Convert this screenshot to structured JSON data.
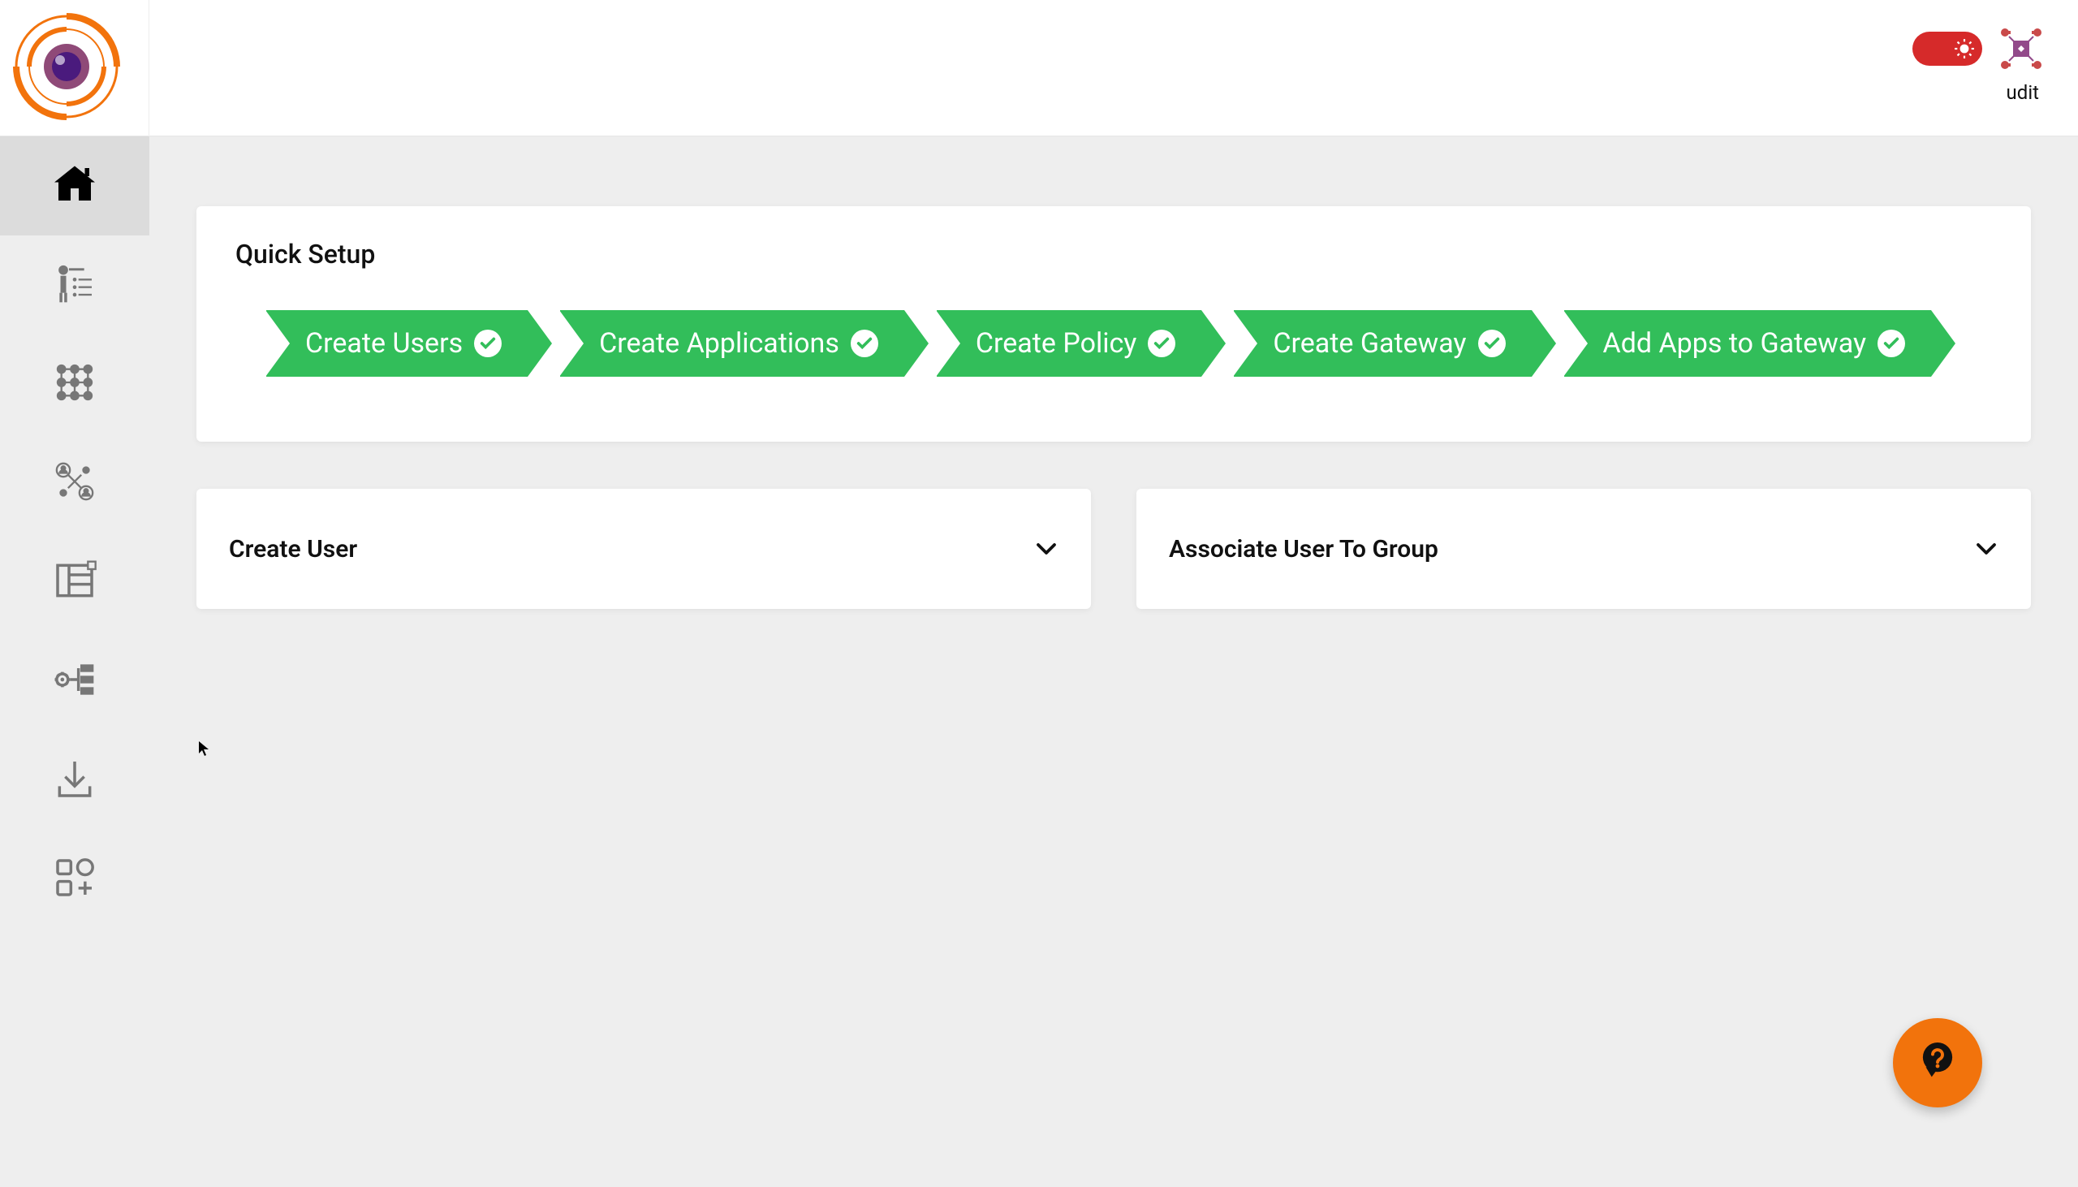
{
  "header": {
    "user_name": "udit"
  },
  "sidebar": {
    "items": [
      {
        "name": "home"
      },
      {
        "name": "onboarding"
      },
      {
        "name": "grid"
      },
      {
        "name": "user-network"
      },
      {
        "name": "layout"
      },
      {
        "name": "tree-config"
      },
      {
        "name": "download"
      },
      {
        "name": "add-module"
      }
    ]
  },
  "quick_setup": {
    "title": "Quick Setup",
    "steps": [
      {
        "label": "Create Users",
        "completed": true
      },
      {
        "label": "Create Applications",
        "completed": true
      },
      {
        "label": "Create Policy",
        "completed": true
      },
      {
        "label": "Create Gateway",
        "completed": true
      },
      {
        "label": "Add Apps to Gateway",
        "completed": true
      }
    ]
  },
  "panels": [
    {
      "title": "Create User"
    },
    {
      "title": "Associate User To Group"
    }
  ],
  "colors": {
    "accent_green": "#32be5a",
    "accent_orange": "#f2730c",
    "toggle_red": "#d62a2a"
  }
}
